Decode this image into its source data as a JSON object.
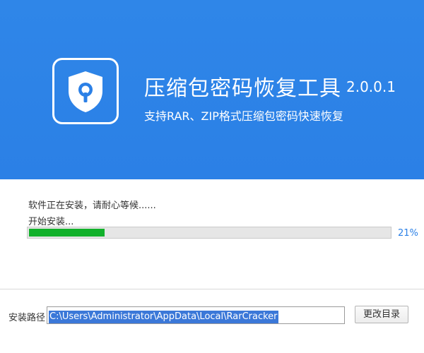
{
  "header": {
    "title": "压缩包密码恢复工具",
    "version": "2.0.0.1",
    "subtitle": "支持RAR、ZIP格式压缩包密码快速恢复",
    "logo_icon": "shield-keyhole-icon",
    "background_color": "#2b80e6"
  },
  "progress": {
    "status_text": "软件正在安装，请耐心等候......",
    "step_text": "开始安装...",
    "percent_value": 21,
    "percent_label": "21%",
    "fill_color": "#12b12b"
  },
  "install": {
    "path_label": "安装路径",
    "path_value": "C:\\Users\\Administrator\\AppData\\Local\\RarCracker",
    "change_button_label": "更改目录"
  }
}
